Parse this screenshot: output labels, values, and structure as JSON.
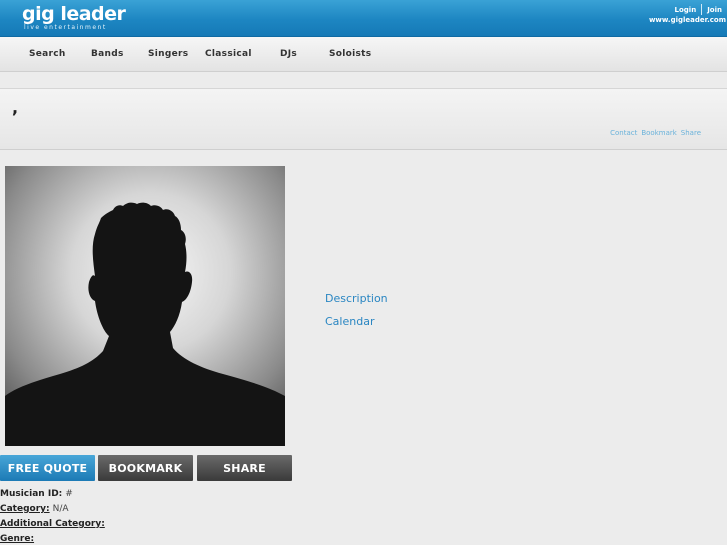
{
  "header": {
    "logo_main": "gig leader",
    "logo_sub": "live entertainment",
    "login_label": "Login",
    "join_label": "Join",
    "site_url": "www.gigleader.com"
  },
  "nav": {
    "items": [
      "Search",
      "Bands",
      "Singers",
      "Classical",
      "DJs",
      "Soloists"
    ]
  },
  "profile": {
    "name": ",",
    "panel_links": [
      "Contact",
      "Bookmark",
      "Share"
    ]
  },
  "side_links": [
    "Description",
    "Calendar"
  ],
  "buttons": {
    "quote": "FREE QUOTE",
    "bookmark": "BOOKMARK",
    "share": "SHARE"
  },
  "info": {
    "musician_id_label": "Musician ID:",
    "musician_id_value": "#",
    "category_label": "Category:",
    "category_value": "N/A",
    "additional_category_label": "Additional Category:",
    "genre_label": "Genre:"
  },
  "colors": {
    "brand_blue": "#1d86c2",
    "link_blue": "#2a86c2",
    "dark_button": "#3a3a3a"
  }
}
